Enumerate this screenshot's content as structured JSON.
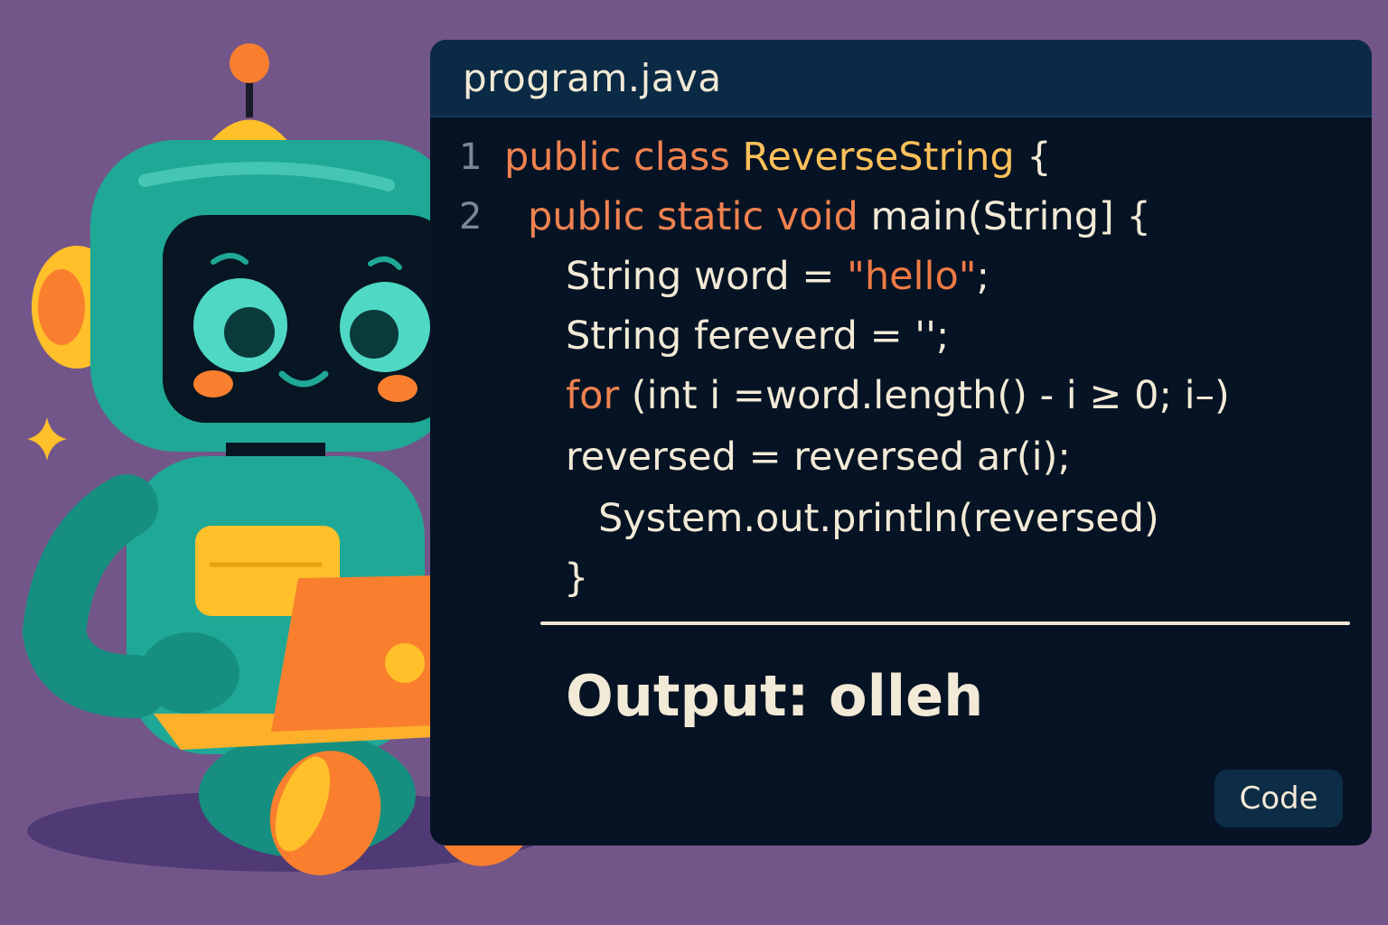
{
  "editor": {
    "filename": "program.java",
    "lines": [
      {
        "num": "1",
        "a": "public class ",
        "b": "ReverseString",
        "c": " {"
      },
      {
        "num": "2",
        "a": "public static void ",
        "b": "main(String] {"
      },
      {
        "a": "String word = ",
        "b": "\"hello\"",
        "c": ";"
      },
      {
        "a": "String fereverd = '';"
      },
      {
        "a": "for",
        "b": " (int i =word.length() - i ≥ 0; i–)"
      },
      {
        "a": "reversed = reversed ar(i);"
      },
      {
        "a": "System.out.println(reversed)"
      },
      {
        "a": "}"
      }
    ],
    "output": "Output: olleh",
    "code_button": "Code"
  },
  "colors": {
    "background": "#735689",
    "panel": "#061324",
    "titlebar": "#0b2a45",
    "keyword": "#f0824f",
    "classname": "#ffc15a",
    "text": "#f2ead6",
    "robot_teal": "#1fa896",
    "robot_orange": "#f97f2f",
    "robot_yellow": "#ffc02a"
  },
  "icons": [
    "robot-mascot",
    "laptop-icon",
    "sparkle-icon"
  ]
}
